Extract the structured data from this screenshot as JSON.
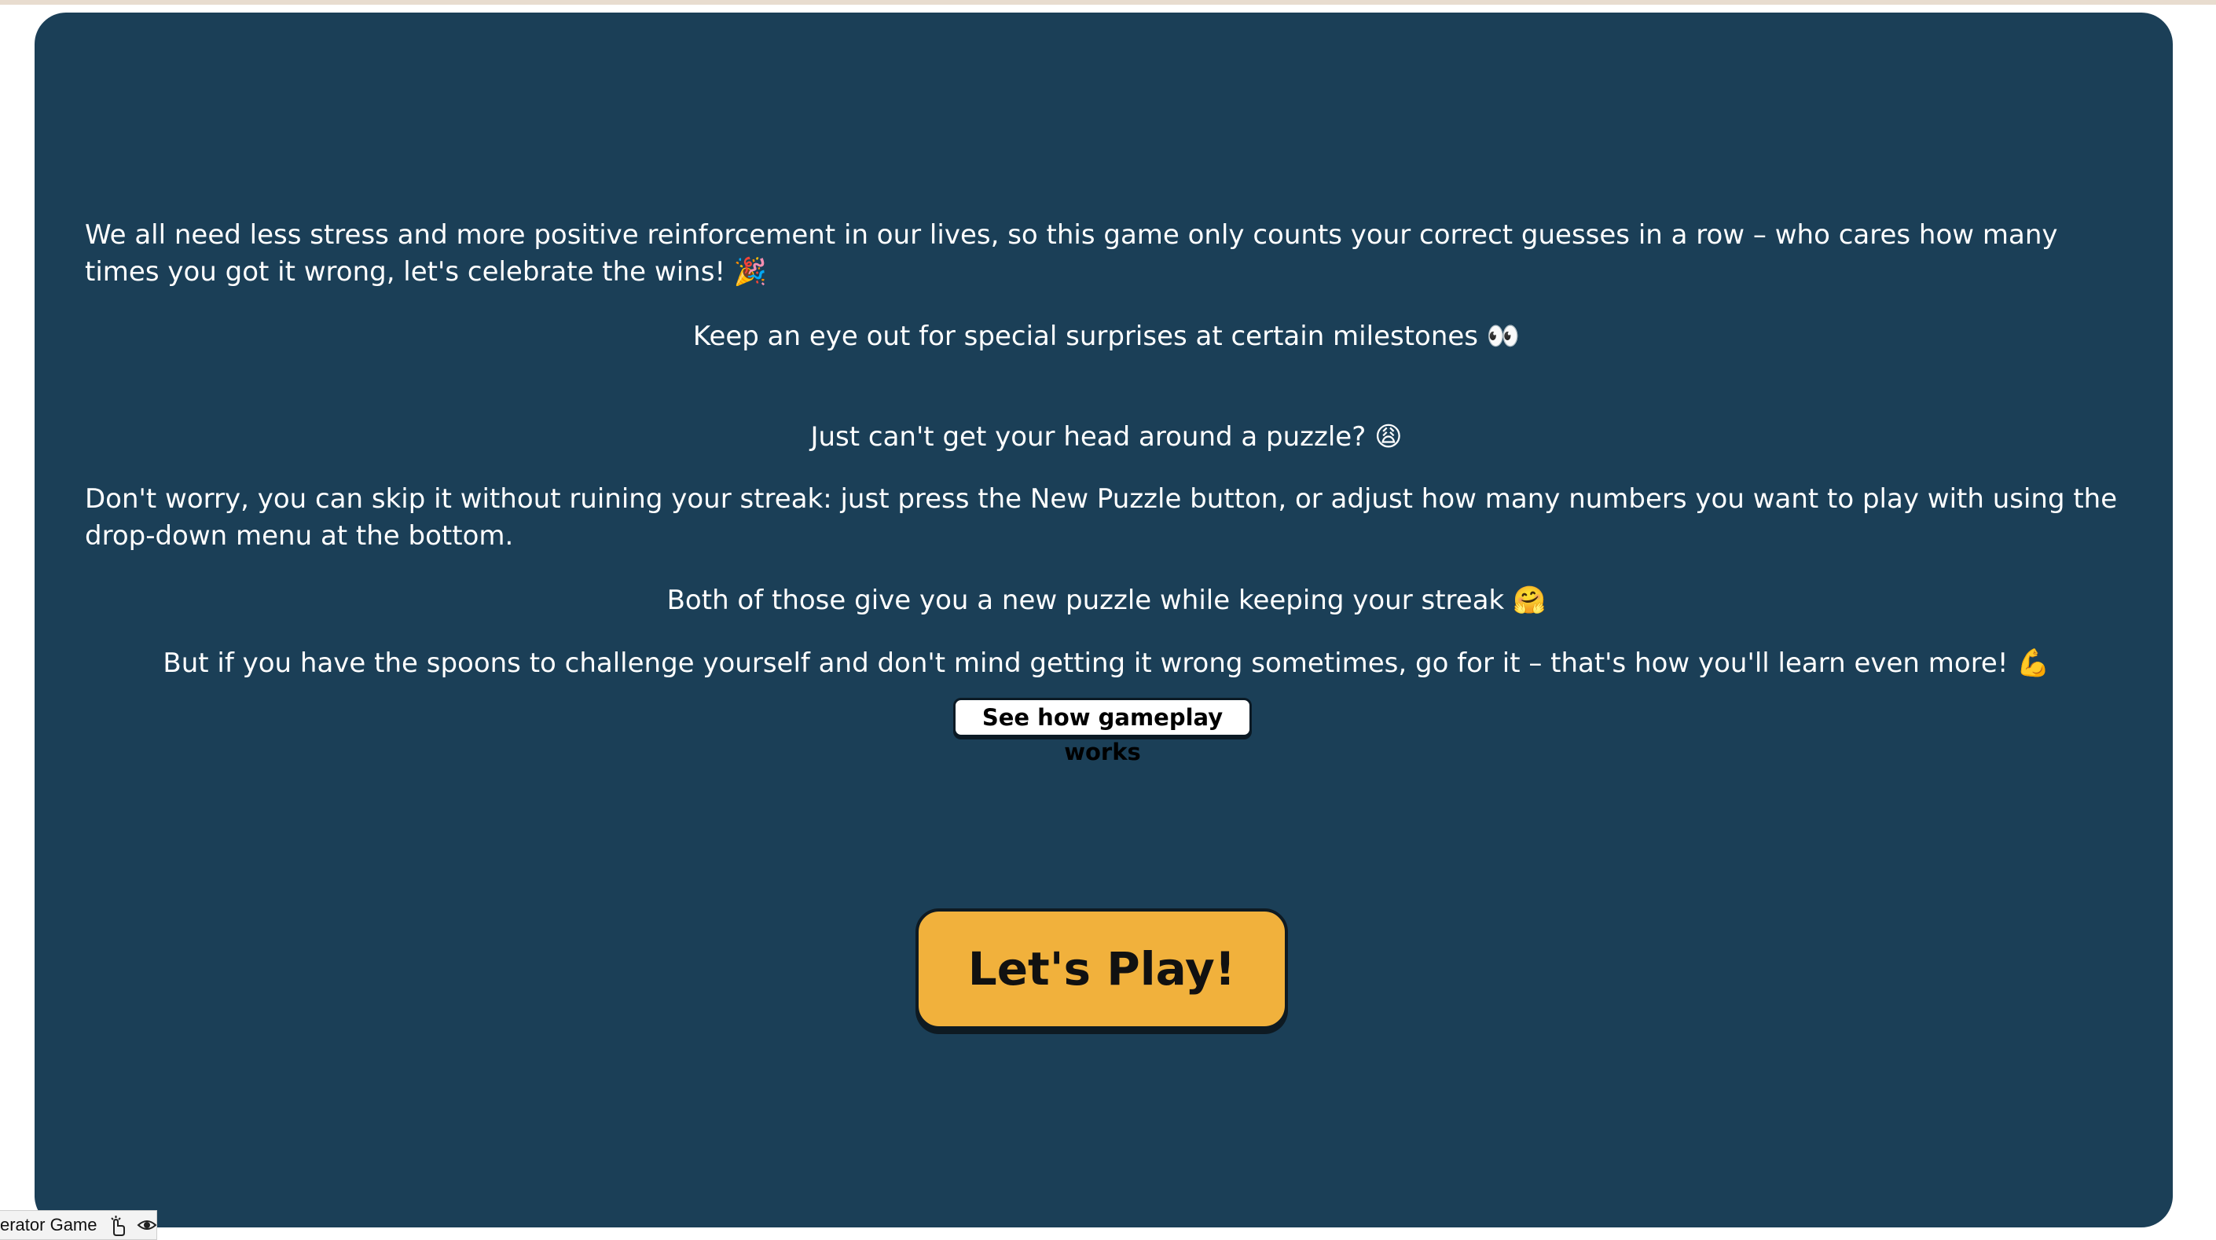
{
  "intro": {
    "paragraph_1": "We all need less stress and more positive reinforcement in our lives, so this game only counts your correct guesses in a row – who cares how many times you got it wrong, let's celebrate the wins! 🎉",
    "paragraph_2": "Keep an eye out for special surprises at certain milestones 👀",
    "paragraph_3": "Just can't get your head around a puzzle? 😩",
    "paragraph_4": "Don't worry, you can skip it without ruining your streak: just press the New Puzzle button, or adjust how many numbers you want to play with using the drop-down menu at the bottom.",
    "paragraph_5": "Both of those give you a new puzzle while keeping your streak 🤗",
    "paragraph_6": "But if you have the spoons to challenge yourself and don't mind getting it wrong sometimes, go for it – that's how you'll learn even more! 💪"
  },
  "buttons": {
    "gameplay_label": "See how gameplay works",
    "play_label": "Let's Play!"
  },
  "tab": {
    "title": "erator Game"
  },
  "colors": {
    "card_background": "#1b3f57",
    "play_button": "#f1b13c",
    "text": "#ffffff"
  },
  "icons": {
    "tab_pointer": "hand-pointer-icon",
    "tab_view": "eye-icon"
  }
}
